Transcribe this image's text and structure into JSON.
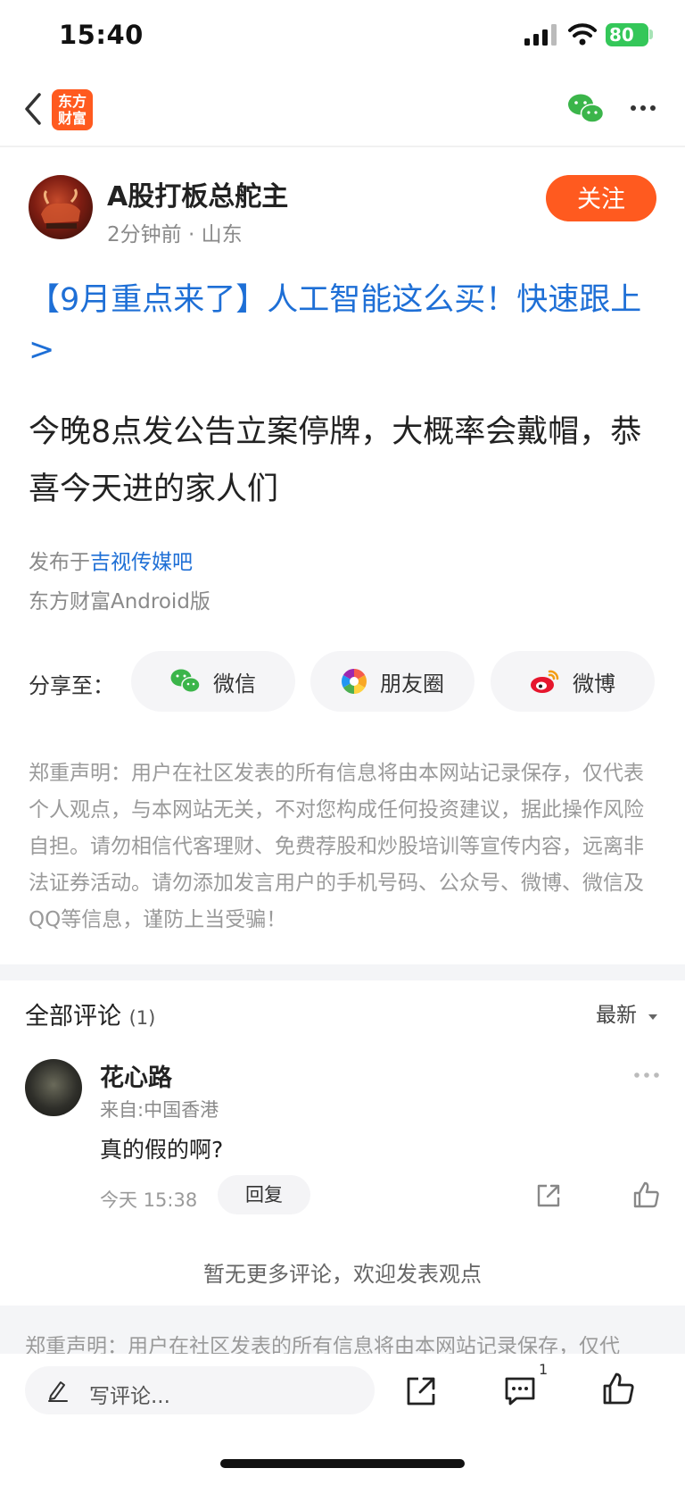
{
  "status_bar": {
    "time": "15:40",
    "battery": "80"
  },
  "nav": {
    "logo_line1": "东方",
    "logo_line2": "财富"
  },
  "author": {
    "name": "A股打板总舵主",
    "meta": "2分钟前 · 山东",
    "follow_label": "关注"
  },
  "post": {
    "promo": "【9月重点来了】人工智能这么买！快速跟上>",
    "body": "今晚8点发公告立案停牌，大概率会戴帽，恭喜今天进的家人们",
    "published_prefix": "发布于",
    "bar_name": "吉视传媒吧",
    "source": "东方财富Android版"
  },
  "share": {
    "label": "分享至：",
    "wechat": "微信",
    "moments": "朋友圈",
    "weibo": "微博"
  },
  "disclaimer": "郑重声明：用户在社区发表的所有信息将由本网站记录保存，仅代表个人观点，与本网站无关，不对您构成任何投资建议，据此操作风险自担。请勿相信代客理财、免费荐股和炒股培训等宣传内容，远离非法证券活动。请勿添加发言用户的手机号码、公众号、微博、微信及QQ等信息，谨防上当受骗！",
  "comments": {
    "title": "全部评论",
    "count": "(1)",
    "sort": "最新",
    "items": [
      {
        "name": "花心路",
        "from": "来自:中国香港",
        "text": "真的假的啊?",
        "time": "今天 15:38",
        "reply": "回复"
      }
    ],
    "no_more": "暂无更多评论，欢迎发表观点"
  },
  "footer_disclaimer": "郑重声明：用户在社区发表的所有信息将由本网站记录保存，仅代",
  "bottom_bar": {
    "placeholder": "写评论...",
    "comment_count": "1"
  },
  "colors": {
    "accent": "#ff5a1f",
    "link": "#1e6fd6",
    "wechat_green": "#3bb54a",
    "battery_green": "#34c759"
  }
}
